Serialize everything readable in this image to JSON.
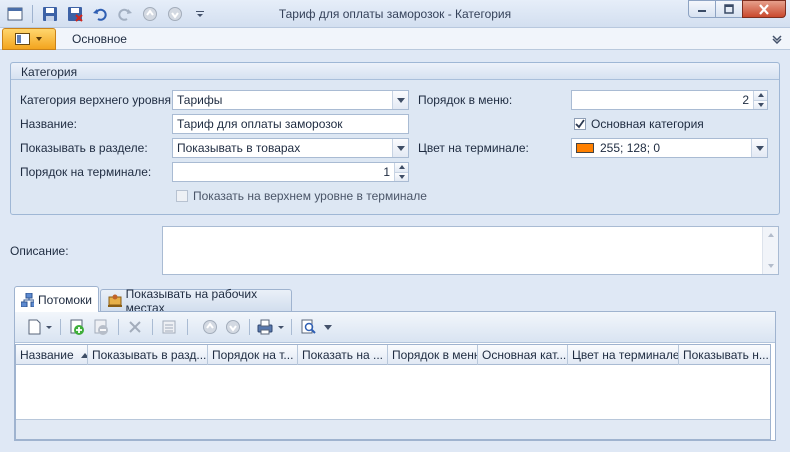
{
  "window": {
    "title": "Тариф для оплаты заморозок - Категория"
  },
  "ribbon": {
    "tab_main": "Основное"
  },
  "group": {
    "title": "Категория",
    "parent_label": "Категория верхнего уровня:",
    "parent_value": "Тарифы",
    "name_label": "Название:",
    "name_value": "Тариф для оплаты заморозок",
    "show_in_label": "Показывать в разделе:",
    "show_in_value": "Показывать в товарах",
    "terminal_order_label": "Порядок на терминале:",
    "terminal_order_value": "1",
    "show_top_level_label": "Показать на верхнем уровне в терминале",
    "show_top_level_checked": false,
    "menu_order_label": "Порядок в меню:",
    "menu_order_value": "2",
    "main_category_label": "Основная категория",
    "main_category_checked": true,
    "terminal_color_label": "Цвет на терминале:",
    "terminal_color_value": "255; 128; 0",
    "terminal_color_hex": "#ff8000"
  },
  "description": {
    "label": "Описание:",
    "value": ""
  },
  "tabs": [
    {
      "label": "Потомоки",
      "icon": "hierarchy-icon",
      "active": true
    },
    {
      "label": "Показывать на рабочих местах",
      "icon": "workstation-icon",
      "active": false
    }
  ],
  "grid": {
    "columns": [
      "Название",
      "Показывать в разд...",
      "Порядок на т...",
      "Показать на ...",
      "Порядок в меню",
      "Основная кат...",
      "Цвет на терминале",
      "Показывать н..."
    ],
    "sort_column": "Название",
    "rows": []
  },
  "colors": {
    "accent": "#f3a41e",
    "background": "#dfe8f5",
    "border": "#9fb3cf"
  }
}
